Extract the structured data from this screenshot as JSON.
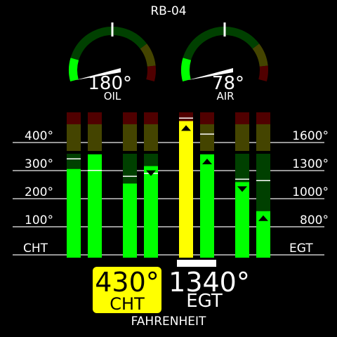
{
  "title": "RB-04",
  "gauges": [
    {
      "name": "OIL",
      "value_label": "180°",
      "value_fraction": 0.0
    },
    {
      "name": "AIR",
      "value_label": "78°",
      "value_fraction": 0.0
    }
  ],
  "scale": {
    "cht_labels": [
      "400°",
      "300°",
      "200°",
      "100°"
    ],
    "egt_labels": [
      "1600°",
      "1300°",
      "1000°",
      "800°"
    ],
    "cht_name": "CHT",
    "egt_name": "EGT"
  },
  "cylinders": [
    {
      "cht_fraction": 0.61,
      "egt_fraction": 0.71,
      "cht_peak_fraction": 0.68,
      "egt_peak_fraction": 0.6,
      "cht_marker": false,
      "egt_marker": false
    },
    {
      "cht_fraction": 0.51,
      "egt_fraction": 0.63,
      "cht_peak_fraction": 0.56,
      "egt_peak_fraction": 0.58,
      "cht_marker": false,
      "egt_marker": true
    },
    {
      "cht_fraction": 0.94,
      "egt_fraction": 0.71,
      "cht_peak_fraction": 0.96,
      "egt_peak_fraction": 0.85,
      "cht_marker": true,
      "egt_marker": true
    },
    {
      "cht_fraction": 0.52,
      "egt_fraction": 0.32,
      "cht_peak_fraction": 0.54,
      "egt_peak_fraction": 0.53,
      "cht_marker": true,
      "egt_marker": true
    }
  ],
  "colors": {
    "normal": "#00ff00",
    "normal_dim": "#004000",
    "caution": "#ffff00",
    "caution_dim": "#444400",
    "danger_dim": "#500000",
    "scale_line": "#c8c8c8"
  },
  "readout": {
    "cht_value": "430°",
    "cht_unit": "CHT",
    "egt_value": "1340°",
    "egt_unit": "EGT",
    "units": "FAHRENHEIT"
  }
}
